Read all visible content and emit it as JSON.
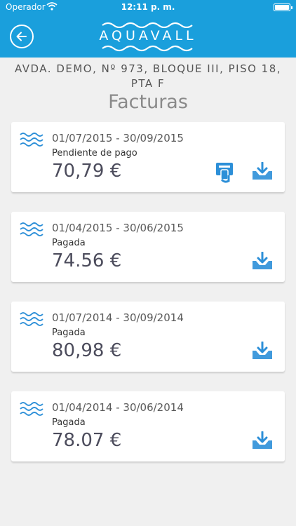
{
  "status_bar": {
    "carrier": "Operador",
    "time": "12:11 p. m."
  },
  "header": {
    "logo_text": "AQUAVALL"
  },
  "address": "AVDA. DEMO, Nº 973, BLOQUE III, PISO 18, PTA F",
  "page_title": "Facturas",
  "colors": {
    "brand": "#1a9fdc",
    "icon_blue": "#2c8fd8",
    "background": "#f0f0f0"
  },
  "invoices": [
    {
      "period": "01/07/2015 - 30/09/2015",
      "status": "Pendiente de pago",
      "amount": "70,79 €",
      "payable": true
    },
    {
      "period": "01/04/2015 - 30/06/2015",
      "status": "Pagada",
      "amount": "74.56 €",
      "payable": false
    },
    {
      "period": "01/07/2014 - 30/09/2014",
      "status": "Pagada",
      "amount": "80,98 €",
      "payable": false
    },
    {
      "period": "01/04/2014 - 30/06/2014",
      "status": "Pagada",
      "amount": "78.07 €",
      "payable": false
    }
  ],
  "icons": {
    "back": "back-arrow-icon",
    "invoice": "water-waves-icon",
    "pay": "card-payment-icon",
    "download": "download-icon"
  }
}
